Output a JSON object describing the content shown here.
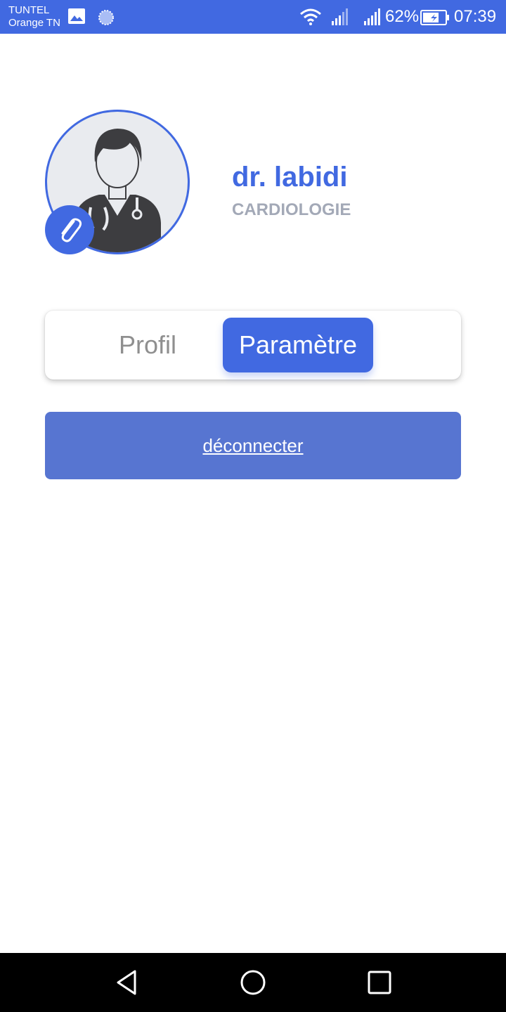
{
  "status_bar": {
    "carrier_line1": "TUNTEL",
    "carrier_line2": "Orange TN",
    "battery": "62%",
    "time": "07:39",
    "icons": [
      "gallery-icon",
      "loading-icon",
      "wifi-icon",
      "signal-icon",
      "signal-icon",
      "battery-charging-icon"
    ]
  },
  "profile": {
    "name": "dr. labidi",
    "specialty": "CARDIOLOGIE",
    "avatar_icon": "doctor-avatar-icon",
    "edit_icon": "paperclip-icon"
  },
  "tabs": {
    "items": [
      {
        "label": "Profil",
        "active": false
      },
      {
        "label": "Paramètre",
        "active": true
      }
    ]
  },
  "logout": {
    "label": "déconnecter"
  },
  "nav": {
    "icons": [
      "back-icon",
      "home-icon",
      "recents-icon"
    ]
  },
  "colors": {
    "accent": "#4169e1",
    "logout_button": "#5775d1",
    "specialty_text": "#a3a9b7",
    "inactive_tab_text": "#8f8f8f"
  }
}
